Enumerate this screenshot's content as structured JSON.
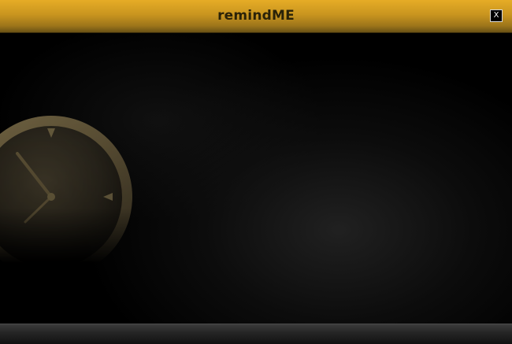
{
  "window": {
    "title": "remindME",
    "close_label": "X"
  },
  "icons": {
    "clock": "clock-icon",
    "close": "close-icon"
  },
  "colors": {
    "title_bar": "#d6a023",
    "title_text": "#2a2208",
    "background": "#000000",
    "clock_tint": "#6e6040"
  }
}
